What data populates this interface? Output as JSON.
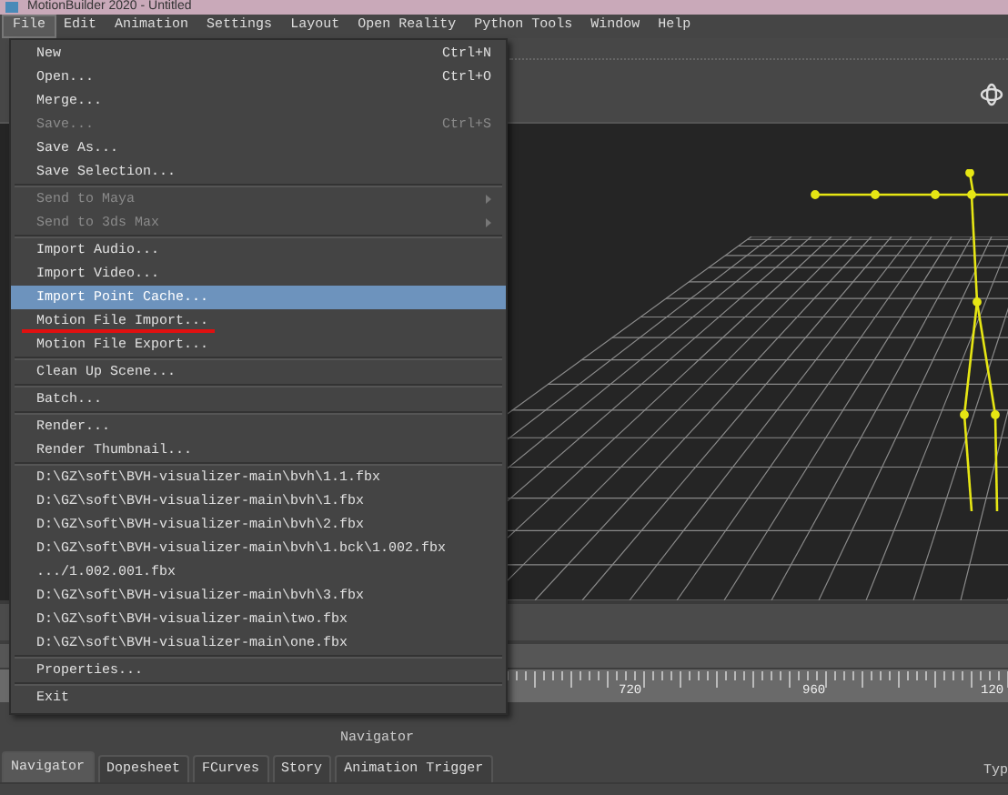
{
  "window": {
    "title": "MotionBuilder 2020 - Untitled"
  },
  "menubar": [
    {
      "label": "File",
      "selected": true
    },
    {
      "label": "Edit",
      "selected": false
    },
    {
      "label": "Animation",
      "selected": false
    },
    {
      "label": "Settings",
      "selected": false
    },
    {
      "label": "Layout",
      "selected": false
    },
    {
      "label": "Open Reality",
      "selected": false
    },
    {
      "label": "Python Tools",
      "selected": false
    },
    {
      "label": "Window",
      "selected": false
    },
    {
      "label": "Help",
      "selected": false
    }
  ],
  "file_menu": [
    {
      "kind": "item",
      "label": "New",
      "shortcut": "Ctrl+N",
      "disabled": false,
      "selected": false,
      "underlined": false
    },
    {
      "kind": "item",
      "label": "Open...",
      "shortcut": "Ctrl+O",
      "disabled": false,
      "selected": false,
      "underlined": false
    },
    {
      "kind": "item",
      "label": "Merge...",
      "disabled": false,
      "selected": false,
      "underlined": false
    },
    {
      "kind": "item",
      "label": "Save...",
      "shortcut": "Ctrl+S",
      "disabled": true,
      "selected": false,
      "underlined": false
    },
    {
      "kind": "item",
      "label": "Save As...",
      "disabled": false,
      "selected": false,
      "underlined": false
    },
    {
      "kind": "item",
      "label": "Save Selection...",
      "disabled": false,
      "selected": false,
      "underlined": false
    },
    {
      "kind": "separator"
    },
    {
      "kind": "submenu",
      "label": "Send to Maya",
      "disabled": true,
      "selected": false,
      "underlined": false
    },
    {
      "kind": "submenu",
      "label": "Send to 3ds Max",
      "disabled": true,
      "selected": false,
      "underlined": false
    },
    {
      "kind": "separator"
    },
    {
      "kind": "item",
      "label": "Import Audio...",
      "disabled": false,
      "selected": false,
      "underlined": false
    },
    {
      "kind": "item",
      "label": "Import Video...",
      "disabled": false,
      "selected": false,
      "underlined": false
    },
    {
      "kind": "item",
      "label": "Import Point Cache...",
      "disabled": false,
      "selected": true,
      "underlined": false
    },
    {
      "kind": "item",
      "label": "Motion File Import...",
      "disabled": false,
      "selected": false,
      "underlined": true
    },
    {
      "kind": "item",
      "label": "Motion File Export...",
      "disabled": false,
      "selected": false,
      "underlined": false
    },
    {
      "kind": "separator"
    },
    {
      "kind": "item",
      "label": "Clean Up Scene...",
      "disabled": false,
      "selected": false,
      "underlined": false
    },
    {
      "kind": "separator"
    },
    {
      "kind": "item",
      "label": "Batch...",
      "disabled": false,
      "selected": false,
      "underlined": false
    },
    {
      "kind": "separator"
    },
    {
      "kind": "item",
      "label": "Render...",
      "disabled": false,
      "selected": false,
      "underlined": false
    },
    {
      "kind": "item",
      "label": "Render Thumbnail...",
      "disabled": false,
      "selected": false,
      "underlined": false
    },
    {
      "kind": "separator"
    },
    {
      "kind": "item",
      "label": "D:\\GZ\\soft\\BVH-visualizer-main\\bvh\\1.1.fbx",
      "disabled": false,
      "selected": false,
      "underlined": false
    },
    {
      "kind": "item",
      "label": "D:\\GZ\\soft\\BVH-visualizer-main\\bvh\\1.fbx",
      "disabled": false,
      "selected": false,
      "underlined": false
    },
    {
      "kind": "item",
      "label": "D:\\GZ\\soft\\BVH-visualizer-main\\bvh\\2.fbx",
      "disabled": false,
      "selected": false,
      "underlined": false
    },
    {
      "kind": "item",
      "label": "D:\\GZ\\soft\\BVH-visualizer-main\\bvh\\1.bck\\1.002.fbx",
      "disabled": false,
      "selected": false,
      "underlined": false
    },
    {
      "kind": "item",
      "label": ".../1.002.001.fbx",
      "disabled": false,
      "selected": false,
      "underlined": false
    },
    {
      "kind": "item",
      "label": "D:\\GZ\\soft\\BVH-visualizer-main\\bvh\\3.fbx",
      "disabled": false,
      "selected": false,
      "underlined": false
    },
    {
      "kind": "item",
      "label": "D:\\GZ\\soft\\BVH-visualizer-main\\two.fbx",
      "disabled": false,
      "selected": false,
      "underlined": false
    },
    {
      "kind": "item",
      "label": "D:\\GZ\\soft\\BVH-visualizer-main\\one.fbx",
      "disabled": false,
      "selected": false,
      "underlined": false
    },
    {
      "kind": "separator"
    },
    {
      "kind": "item",
      "label": "Properties...",
      "disabled": false,
      "selected": false,
      "underlined": false
    },
    {
      "kind": "separator"
    },
    {
      "kind": "item",
      "label": "Exit",
      "disabled": false,
      "selected": false,
      "underlined": false
    }
  ],
  "ruler": {
    "labels": [
      "720",
      "960",
      "120"
    ]
  },
  "navigator_label": "Navigator",
  "tabs": [
    {
      "label": "Navigator",
      "selected": true
    },
    {
      "label": "Dopesheet",
      "selected": false
    },
    {
      "label": "FCurves",
      "selected": false
    },
    {
      "label": "Story",
      "selected": false
    },
    {
      "label": "Animation Trigger",
      "selected": false
    }
  ],
  "corner_text": "Typ"
}
